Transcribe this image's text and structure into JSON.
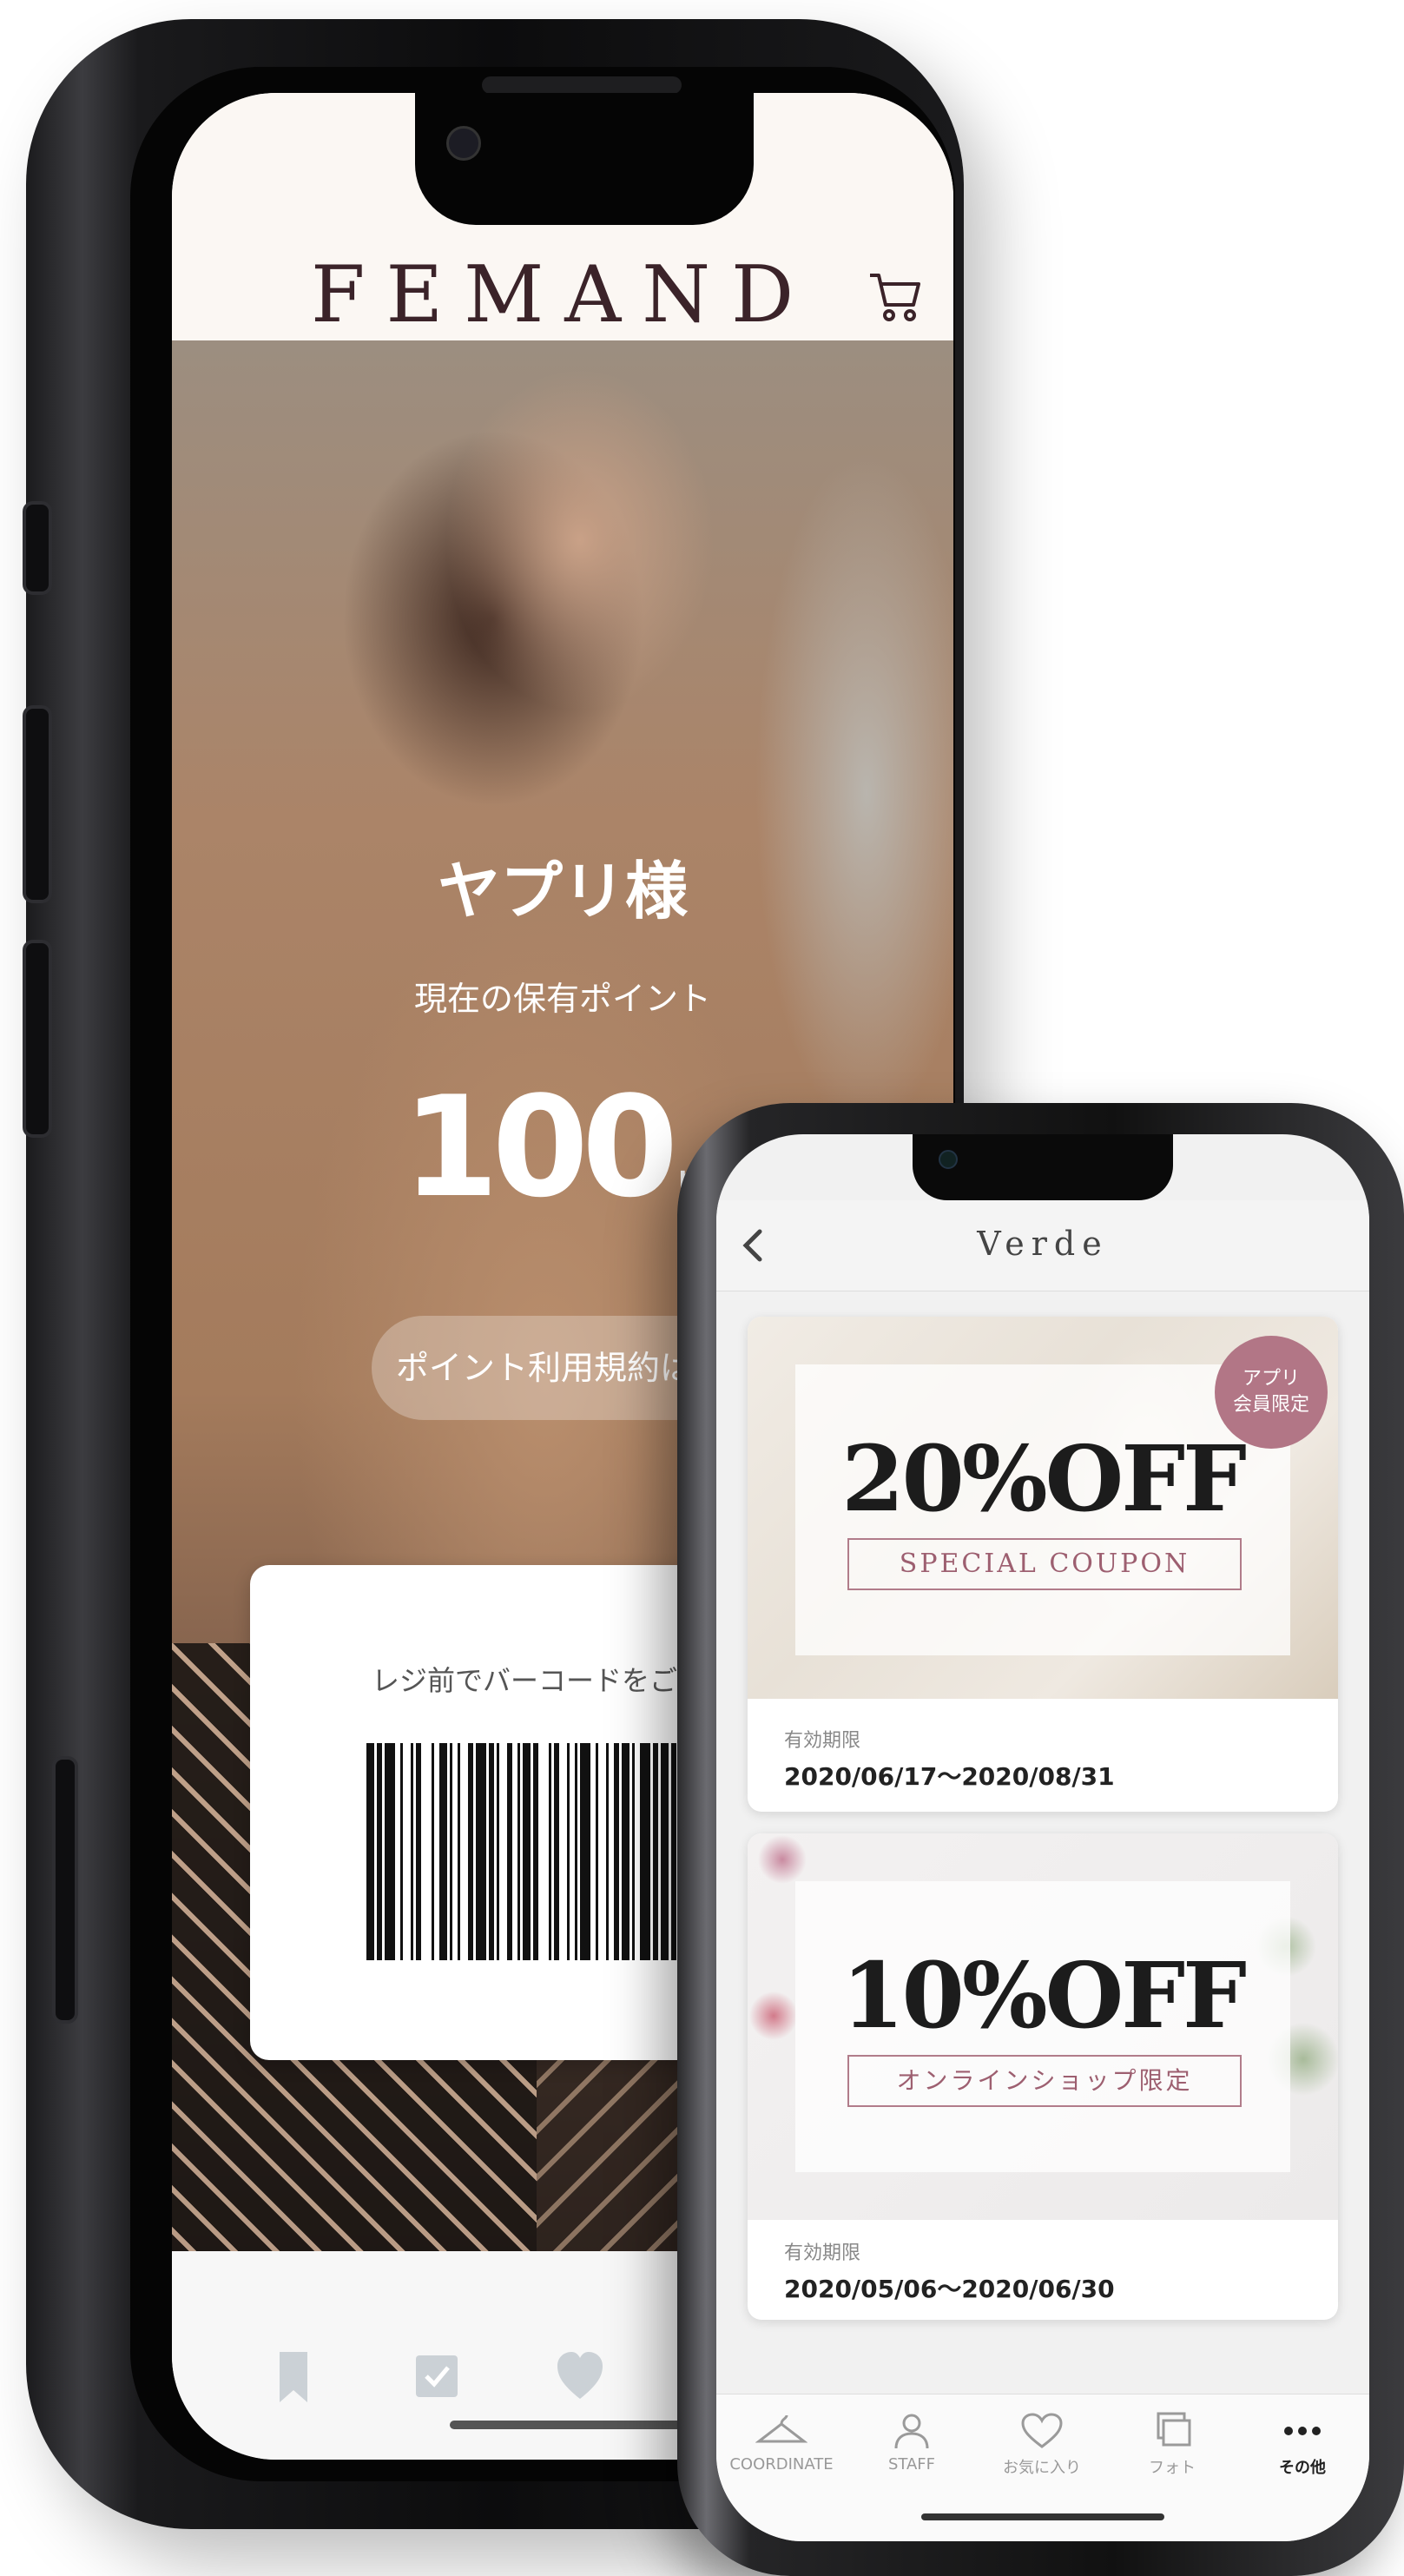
{
  "femand_app": {
    "brand": "FEMAND",
    "greeting": "ヤプリ様",
    "points_label": "現在の保有ポイント",
    "points_value": "100",
    "points_unit": "pt",
    "terms_button": "ポイント利用規約はこち",
    "barcode_hint": "レジ前でバーコードをご提示く",
    "icons": {
      "cart": "cart-icon",
      "tabs": [
        "bookmark-icon",
        "check-box-icon",
        "heart-icon"
      ]
    }
  },
  "verde_app": {
    "title": "Verde",
    "coupons": [
      {
        "discount": "20%OFF",
        "subtitle": "SPECIAL COUPON",
        "badge_line1": "アプリ",
        "badge_line2": "会員限定",
        "expiry_label": "有効期限",
        "expiry_dates": "2020/06/17〜2020/08/31"
      },
      {
        "discount": "10%OFF",
        "subtitle": "オンラインショップ限定",
        "expiry_label": "有効期限",
        "expiry_dates": "2020/05/06〜2020/06/30"
      }
    ],
    "tabs": [
      {
        "label": "COORDINATE",
        "icon": "hanger-icon"
      },
      {
        "label": "STAFF",
        "icon": "person-icon"
      },
      {
        "label": "お気に入り",
        "icon": "heart-icon"
      },
      {
        "label": "フォト",
        "icon": "photos-icon"
      },
      {
        "label": "その他",
        "icon": "more-dots-icon",
        "active": true
      }
    ]
  },
  "colors": {
    "brand_text": "#3b2329",
    "coupon_accent": "#b27686"
  }
}
